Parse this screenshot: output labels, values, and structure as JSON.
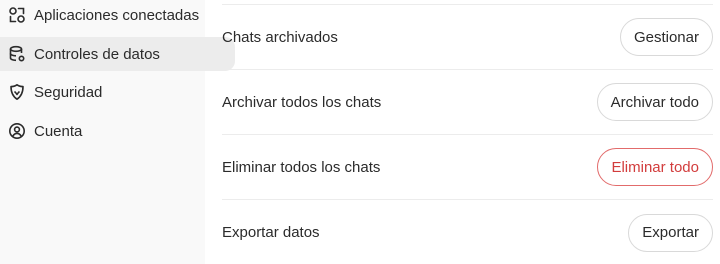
{
  "sidebar": {
    "items": [
      {
        "label": "Aplicaciones conectadas",
        "icon": "apps-link-icon",
        "active": false
      },
      {
        "label": "Controles de datos",
        "icon": "database-settings-icon",
        "active": true
      },
      {
        "label": "Seguridad",
        "icon": "shield-icon",
        "active": false
      },
      {
        "label": "Cuenta",
        "icon": "user-circle-icon",
        "active": false
      }
    ]
  },
  "rows": [
    {
      "label": "Chats archivados",
      "button": "Gestionar",
      "danger": false
    },
    {
      "label": "Archivar todos los chats",
      "button": "Archivar todo",
      "danger": false
    },
    {
      "label": "Eliminar todos los chats",
      "button": "Eliminar todo",
      "danger": true
    },
    {
      "label": "Exportar datos",
      "button": "Exportar",
      "danger": false
    }
  ],
  "colors": {
    "sidebar_bg": "#f9f9f9",
    "active_bg": "#ececec",
    "danger": "#d23c3c",
    "border": "#d9d9d9"
  }
}
